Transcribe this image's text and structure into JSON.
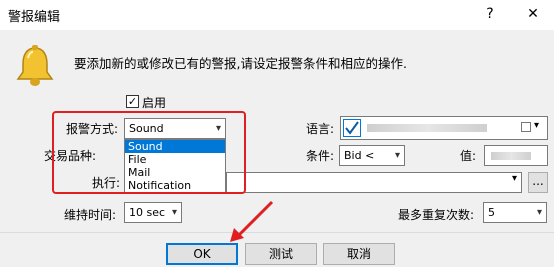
{
  "window": {
    "title": "警报编辑",
    "help_label": "?",
    "close_label": "✕"
  },
  "header": {
    "icon": "bell-icon",
    "intro_text": "要添加新的或修改已有的警报,请设定报警条件和相应的操作."
  },
  "enable": {
    "checked": true,
    "label": "启用"
  },
  "alert_mode": {
    "label": "报警方式:",
    "value": "Sound",
    "options": [
      "Sound",
      "File",
      "Mail",
      "Notification"
    ],
    "selected_index": 0
  },
  "symbol": {
    "label": "交易品种:"
  },
  "execute": {
    "label": "执行:",
    "browse_label": "..."
  },
  "language": {
    "label": "语言:"
  },
  "condition": {
    "label": "条件:",
    "value": "Bid <"
  },
  "value_field": {
    "label": "值:"
  },
  "duration": {
    "label": "维持时间:",
    "value": "10 sec"
  },
  "max_repeat": {
    "label": "最多重复次数:",
    "value": "5"
  },
  "buttons": {
    "ok": "OK",
    "test": "测试",
    "cancel": "取消"
  },
  "annotation_color": "#e02020",
  "accent_color": "#0078d7"
}
